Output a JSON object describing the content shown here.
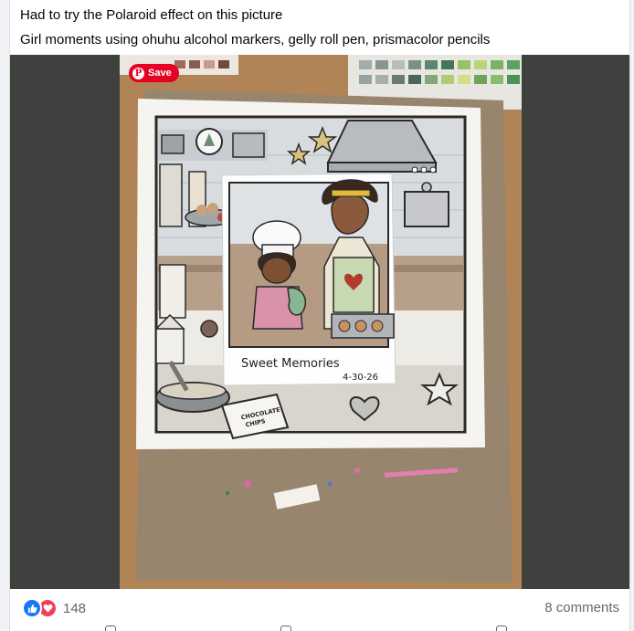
{
  "post": {
    "line1": "Had to try the Polaroid effect on this picture",
    "line2": "Girl moments using ohuhu alcohol markers, gelly roll pen, prismacolor pencils"
  },
  "photo": {
    "save_label": "Save",
    "polaroid_caption": "Sweet Memories",
    "polaroid_date": "4-30-26",
    "jar_label_top": "CHOCOLATE",
    "jar_label_bottom": "CHIPS"
  },
  "footer": {
    "reaction_count": "148",
    "comments_label": "8 comments",
    "icons": [
      "like-icon",
      "love-icon"
    ]
  },
  "colors": {
    "like": "#1877f2",
    "love": "#f33e58",
    "pinterest": "#e60023",
    "secondary_text": "#65676b"
  }
}
